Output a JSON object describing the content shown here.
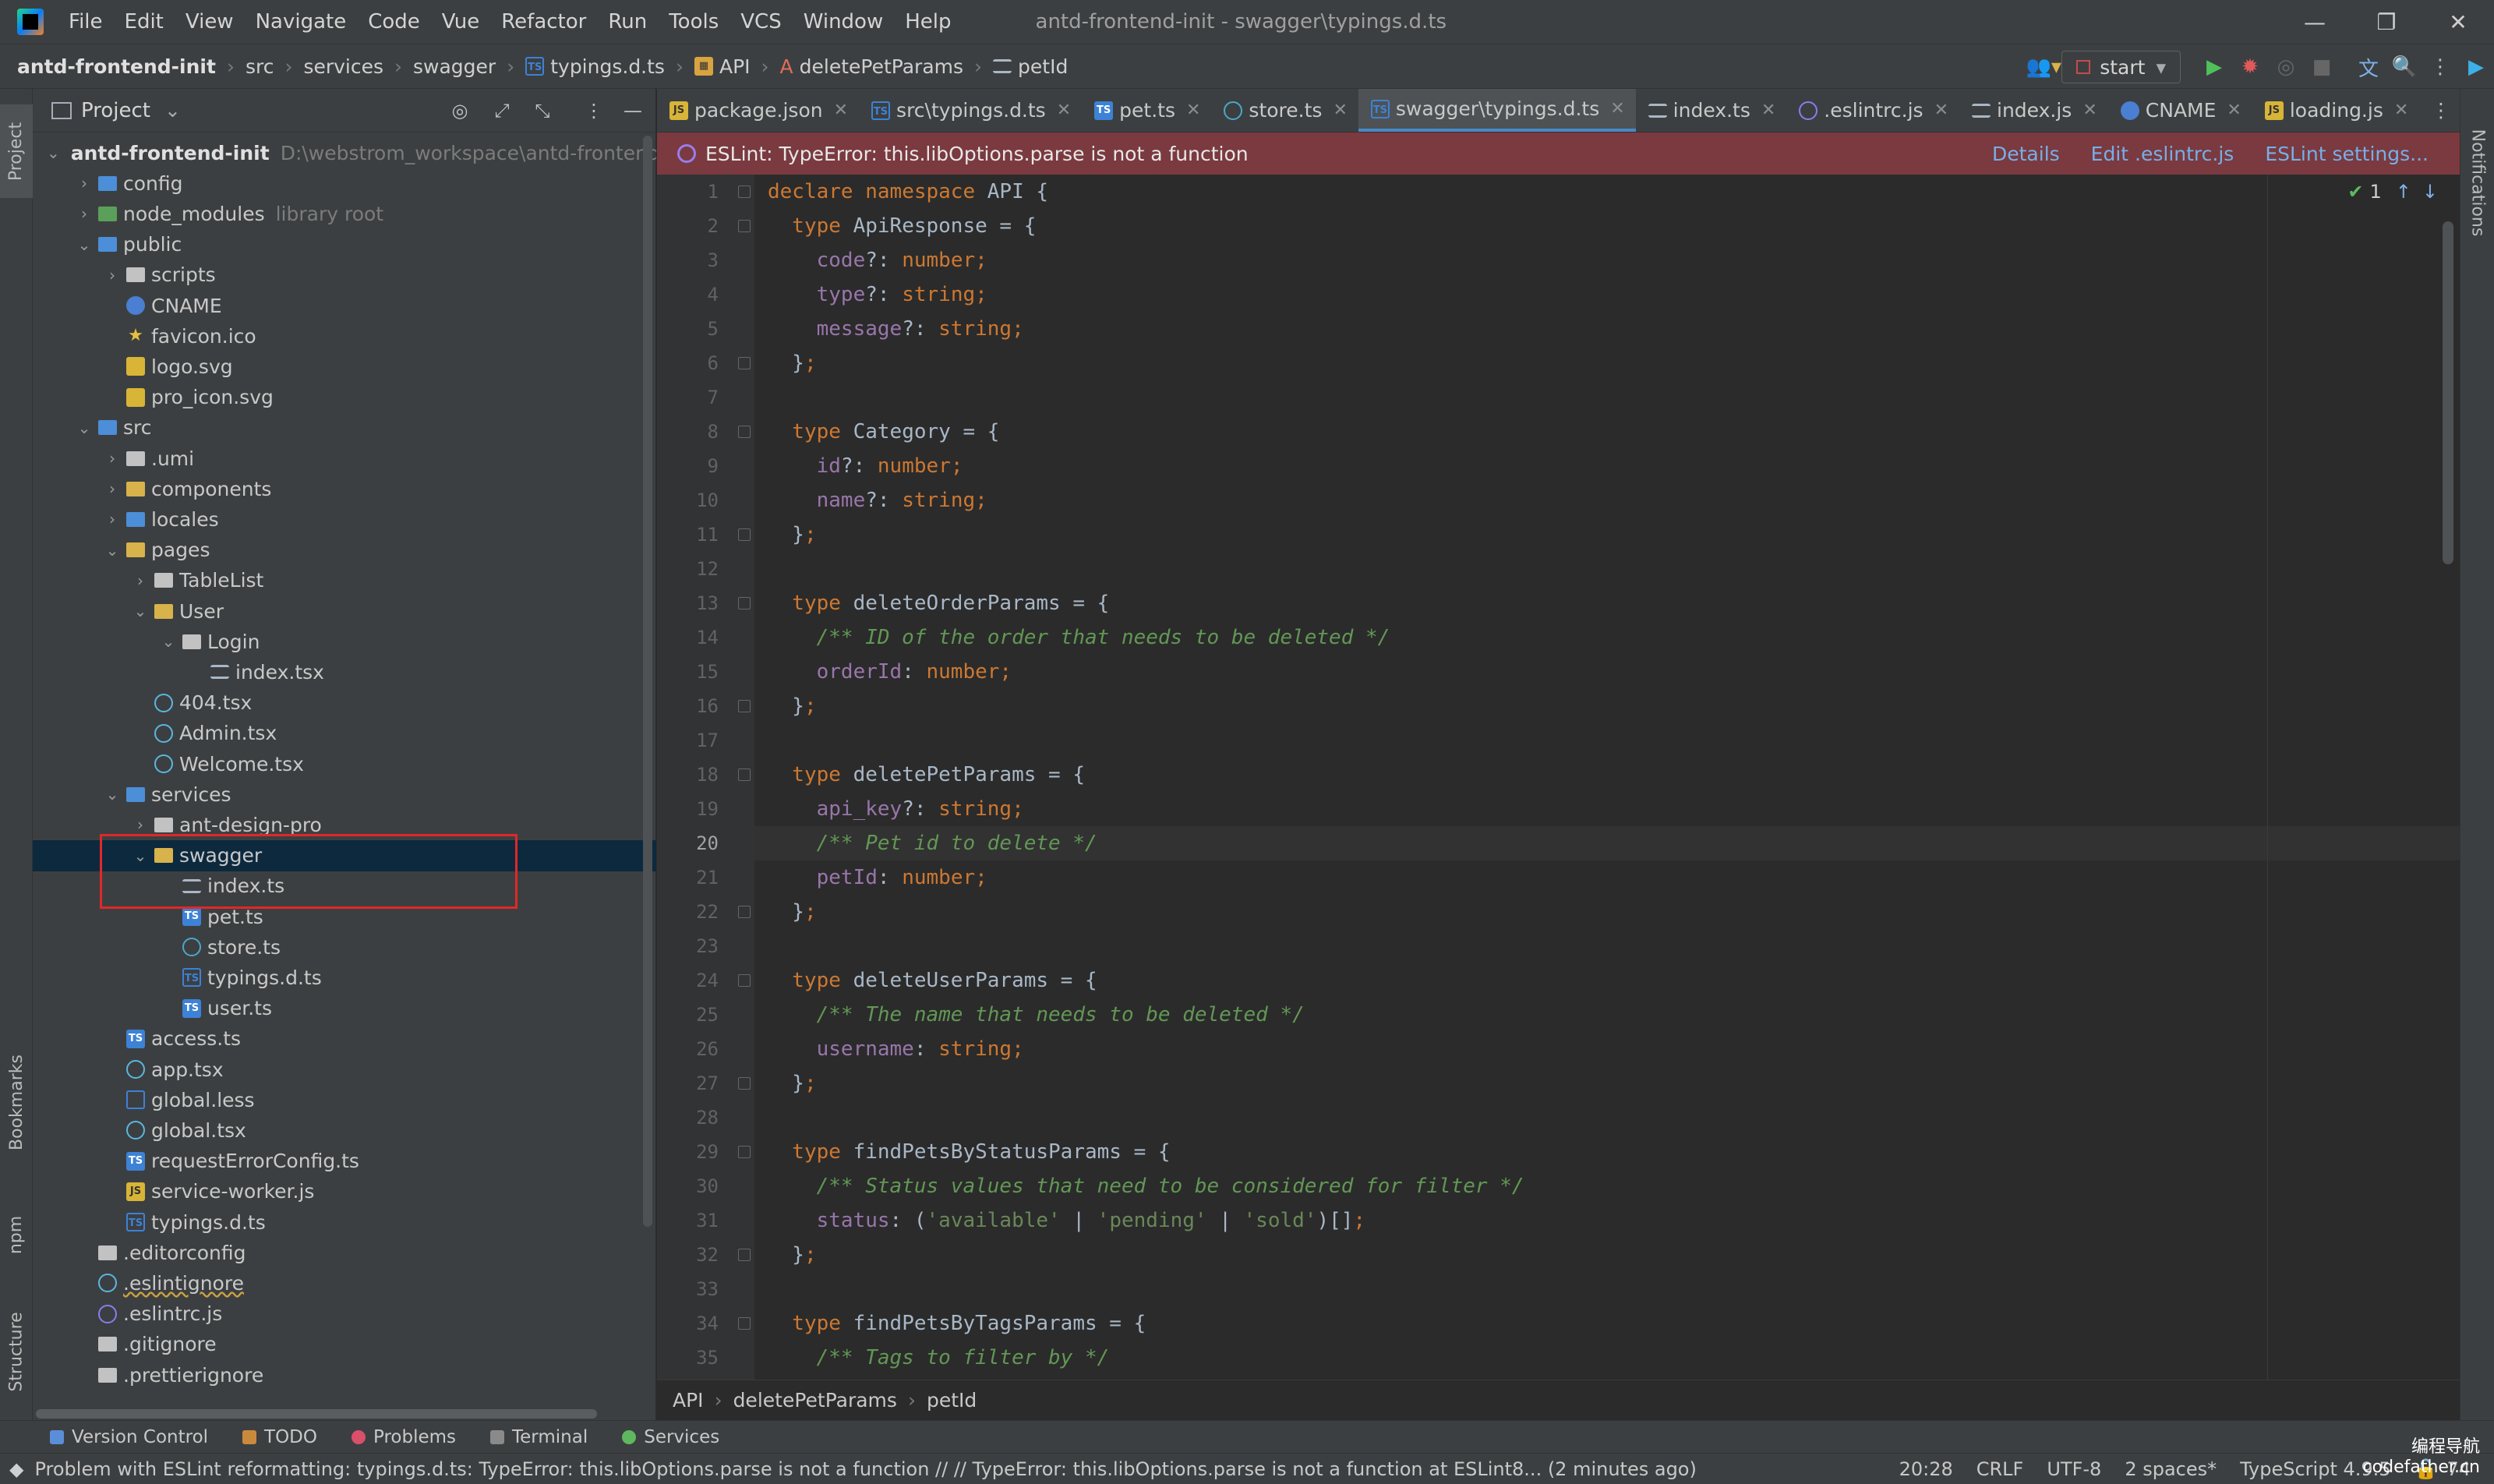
{
  "window": {
    "title": "antd-frontend-init - swagger\\typings.d.ts",
    "controls": [
      "—",
      "❐",
      "✕"
    ]
  },
  "menu": [
    "File",
    "Edit",
    "View",
    "Navigate",
    "Code",
    "Vue",
    "Refactor",
    "Run",
    "Tools",
    "VCS",
    "Window",
    "Help"
  ],
  "navbar": {
    "crumbs": [
      "antd-frontend-init",
      "src",
      "services",
      "swagger",
      "typings.d.ts",
      "API",
      "deletePetParams",
      "petId"
    ],
    "run_config": "start"
  },
  "left_strip": {
    "tabs": [
      "Project",
      "Bookmarks",
      "npm",
      "Structure"
    ]
  },
  "right_strip": {
    "tabs": [
      "Notifications"
    ]
  },
  "project_panel": {
    "title": "Project",
    "tree": [
      {
        "label": "antd-frontend-init",
        "extra": "D:\\webstrom_workspace\\antd-frontend-i",
        "depth": 0,
        "arrow": "open",
        "icon": "folder"
      },
      {
        "label": "config",
        "depth": 1,
        "arrow": "closed",
        "icon": "folder-blue"
      },
      {
        "label": "node_modules",
        "extra": "library root",
        "depth": 1,
        "arrow": "closed",
        "icon": "folder-green"
      },
      {
        "label": "public",
        "depth": 1,
        "arrow": "open",
        "icon": "folder-blue"
      },
      {
        "label": "scripts",
        "depth": 2,
        "arrow": "closed",
        "icon": "folder"
      },
      {
        "label": "CNAME",
        "depth": 2,
        "arrow": "none",
        "icon": "globe"
      },
      {
        "label": "favicon.ico",
        "depth": 2,
        "arrow": "none",
        "icon": "star"
      },
      {
        "label": "logo.svg",
        "depth": 2,
        "arrow": "none",
        "icon": "svg"
      },
      {
        "label": "pro_icon.svg",
        "depth": 2,
        "arrow": "none",
        "icon": "svg"
      },
      {
        "label": "src",
        "depth": 1,
        "arrow": "open",
        "icon": "folder-blue"
      },
      {
        "label": ".umi",
        "depth": 2,
        "arrow": "closed",
        "icon": "folder"
      },
      {
        "label": "components",
        "depth": 2,
        "arrow": "closed",
        "icon": "folder-yellow"
      },
      {
        "label": "locales",
        "depth": 2,
        "arrow": "closed",
        "icon": "folder-blue"
      },
      {
        "label": "pages",
        "depth": 2,
        "arrow": "open",
        "icon": "folder-yellow"
      },
      {
        "label": "TableList",
        "depth": 3,
        "arrow": "closed",
        "icon": "folder"
      },
      {
        "label": "User",
        "depth": 3,
        "arrow": "open",
        "icon": "folder-user"
      },
      {
        "label": "Login",
        "depth": 4,
        "arrow": "open",
        "icon": "folder"
      },
      {
        "label": "index.tsx",
        "depth": 5,
        "arrow": "none",
        "icon": "list"
      },
      {
        "label": "404.tsx",
        "depth": 3,
        "arrow": "none",
        "icon": "react"
      },
      {
        "label": "Admin.tsx",
        "depth": 3,
        "arrow": "none",
        "icon": "react"
      },
      {
        "label": "Welcome.tsx",
        "depth": 3,
        "arrow": "none",
        "icon": "react"
      },
      {
        "label": "services",
        "depth": 2,
        "arrow": "open",
        "icon": "folder-blue"
      },
      {
        "label": "ant-design-pro",
        "depth": 3,
        "arrow": "closed",
        "icon": "folder"
      },
      {
        "label": "swagger",
        "depth": 3,
        "arrow": "open",
        "icon": "folder-yellow",
        "selected": true
      },
      {
        "label": "index.ts",
        "depth": 4,
        "arrow": "none",
        "icon": "list"
      },
      {
        "label": "pet.ts",
        "depth": 4,
        "arrow": "none",
        "icon": "ts"
      },
      {
        "label": "store.ts",
        "depth": 4,
        "arrow": "none",
        "icon": "store"
      },
      {
        "label": "typings.d.ts",
        "depth": 4,
        "arrow": "none",
        "icon": "ts-outline"
      },
      {
        "label": "user.ts",
        "depth": 4,
        "arrow": "none",
        "icon": "ts"
      },
      {
        "label": "access.ts",
        "depth": 2,
        "arrow": "none",
        "icon": "ts"
      },
      {
        "label": "app.tsx",
        "depth": 2,
        "arrow": "none",
        "icon": "react"
      },
      {
        "label": "global.less",
        "depth": 2,
        "arrow": "none",
        "icon": "less"
      },
      {
        "label": "global.tsx",
        "depth": 2,
        "arrow": "none",
        "icon": "react"
      },
      {
        "label": "requestErrorConfig.ts",
        "depth": 2,
        "arrow": "none",
        "icon": "ts"
      },
      {
        "label": "service-worker.js",
        "depth": 2,
        "arrow": "none",
        "icon": "js"
      },
      {
        "label": "typings.d.ts",
        "depth": 2,
        "arrow": "none",
        "icon": "ts-outline"
      },
      {
        "label": ".editorconfig",
        "depth": 1,
        "arrow": "none",
        "icon": "gear"
      },
      {
        "label": ".eslintignore",
        "depth": 1,
        "arrow": "none",
        "icon": "circle",
        "underline": true
      },
      {
        "label": ".eslintrc.js",
        "depth": 1,
        "arrow": "none",
        "icon": "eslint"
      },
      {
        "label": ".gitignore",
        "depth": 1,
        "arrow": "none",
        "icon": "git"
      },
      {
        "label": ".prettierignore",
        "depth": 1,
        "arrow": "none",
        "icon": "prettier"
      }
    ]
  },
  "editor_tabs": [
    {
      "label": "package.json",
      "icon": "json",
      "active": false
    },
    {
      "label": "src\\typings.d.ts",
      "icon": "ts-outline",
      "active": false
    },
    {
      "label": "pet.ts",
      "icon": "ts",
      "active": false
    },
    {
      "label": "store.ts",
      "icon": "store",
      "active": false
    },
    {
      "label": "swagger\\typings.d.ts",
      "icon": "ts-outline",
      "active": true
    },
    {
      "label": "index.ts",
      "icon": "list",
      "active": false
    },
    {
      "label": ".eslintrc.js",
      "icon": "eslint",
      "active": false
    },
    {
      "label": "index.js",
      "icon": "list",
      "active": false
    },
    {
      "label": "CNAME",
      "icon": "globe",
      "active": false
    },
    {
      "label": "loading.js",
      "icon": "js",
      "active": false
    }
  ],
  "eslint_banner": {
    "message": "ESLint: TypeError: this.libOptions.parse is not a function",
    "links": [
      "Details",
      "Edit .eslintrc.js",
      "ESLint settings..."
    ]
  },
  "editor": {
    "inspection_count": "1",
    "current_line": 20,
    "lines": [
      [
        [
          "kw",
          "declare "
        ],
        [
          "kw",
          "namespace "
        ],
        [
          "tn",
          "API {"
        ]
      ],
      [
        [
          "kw",
          "  type "
        ],
        [
          "tn",
          "ApiResponse = {"
        ]
      ],
      [
        [
          "prop",
          "    code"
        ],
        [
          "tn",
          "?: "
        ],
        [
          "kw",
          "number"
        ],
        [
          "kw",
          ";"
        ]
      ],
      [
        [
          "prop",
          "    type"
        ],
        [
          "tn",
          "?: "
        ],
        [
          "kw",
          "string"
        ],
        [
          "kw",
          ";"
        ]
      ],
      [
        [
          "prop",
          "    message"
        ],
        [
          "tn",
          "?: "
        ],
        [
          "kw",
          "string"
        ],
        [
          "kw",
          ";"
        ]
      ],
      [
        [
          "tn",
          "  }"
        ],
        [
          "kw",
          ";"
        ]
      ],
      [],
      [
        [
          "kw",
          "  type "
        ],
        [
          "tn",
          "Category = {"
        ]
      ],
      [
        [
          "prop",
          "    id"
        ],
        [
          "tn",
          "?: "
        ],
        [
          "kw",
          "number"
        ],
        [
          "kw",
          ";"
        ]
      ],
      [
        [
          "prop",
          "    name"
        ],
        [
          "tn",
          "?: "
        ],
        [
          "kw",
          "string"
        ],
        [
          "kw",
          ";"
        ]
      ],
      [
        [
          "tn",
          "  }"
        ],
        [
          "kw",
          ";"
        ]
      ],
      [],
      [
        [
          "kw",
          "  type "
        ],
        [
          "tn",
          "deleteOrderParams = {"
        ]
      ],
      [
        [
          "cm",
          "    /** ID of the order that needs to be deleted */"
        ]
      ],
      [
        [
          "prop",
          "    orderId"
        ],
        [
          "tn",
          ": "
        ],
        [
          "kw",
          "number"
        ],
        [
          "kw",
          ";"
        ]
      ],
      [
        [
          "tn",
          "  }"
        ],
        [
          "kw",
          ";"
        ]
      ],
      [],
      [
        [
          "kw",
          "  type "
        ],
        [
          "tn",
          "deletePetParams = {"
        ]
      ],
      [
        [
          "prop",
          "    api_key"
        ],
        [
          "tn",
          "?: "
        ],
        [
          "kw",
          "string"
        ],
        [
          "kw",
          ";"
        ]
      ],
      [
        [
          "cm",
          "    /** Pet id to delete */"
        ]
      ],
      [
        [
          "prop",
          "    petId"
        ],
        [
          "tn",
          ": "
        ],
        [
          "kw",
          "number"
        ],
        [
          "kw",
          ";"
        ]
      ],
      [
        [
          "tn",
          "  }"
        ],
        [
          "kw",
          ";"
        ]
      ],
      [],
      [
        [
          "kw",
          "  type "
        ],
        [
          "tn",
          "deleteUserParams = {"
        ]
      ],
      [
        [
          "cm",
          "    /** The name that needs to be deleted */"
        ]
      ],
      [
        [
          "prop",
          "    username"
        ],
        [
          "tn",
          ": "
        ],
        [
          "kw",
          "string"
        ],
        [
          "kw",
          ";"
        ]
      ],
      [
        [
          "tn",
          "  }"
        ],
        [
          "kw",
          ";"
        ]
      ],
      [],
      [
        [
          "kw",
          "  type "
        ],
        [
          "tn",
          "findPetsByStatusParams = {"
        ]
      ],
      [
        [
          "cm",
          "    /** Status values that need to be considered for filter */"
        ]
      ],
      [
        [
          "prop",
          "    status"
        ],
        [
          "tn",
          ": ("
        ],
        [
          "str",
          "'available'"
        ],
        [
          "tn",
          " | "
        ],
        [
          "str",
          "'pending'"
        ],
        [
          "tn",
          " | "
        ],
        [
          "str",
          "'sold'"
        ],
        [
          "tn",
          ")[]"
        ],
        [
          "kw",
          ";"
        ]
      ],
      [
        [
          "tn",
          "  }"
        ],
        [
          "kw",
          ";"
        ]
      ],
      [],
      [
        [
          "kw",
          "  type "
        ],
        [
          "tn",
          "findPetsByTagsParams = {"
        ]
      ],
      [
        [
          "cm",
          "    /** Tags to filter by */"
        ]
      ]
    ]
  },
  "editor_breadcrumbs": [
    "API",
    "deletePetParams",
    "petId"
  ],
  "tool_windows": [
    "Version Control",
    "TODO",
    "Problems",
    "Terminal",
    "Services"
  ],
  "statusbar": {
    "message": "Problem with ESLint reformatting: typings.d.ts: TypeError: this.libOptions.parse is not a function // // TypeError: this.libOptions.parse is not a function    at ESLint8... (2 minutes ago)",
    "position": "20:28",
    "line_sep": "CRLF",
    "encoding": "UTF-8",
    "indent": "2 spaces*",
    "language": "TypeScript 4.9.5",
    "memory": "74"
  },
  "watermark": {
    "line1": "编程导航",
    "line2": "codefather.cn"
  },
  "colors": {
    "keyword": "#cc7832",
    "property": "#9876aa",
    "string": "#6a8759",
    "comment": "#629755",
    "error_banner": "#7a3a3f",
    "selection": "#0d293e",
    "highlight_box": "#e02828"
  }
}
